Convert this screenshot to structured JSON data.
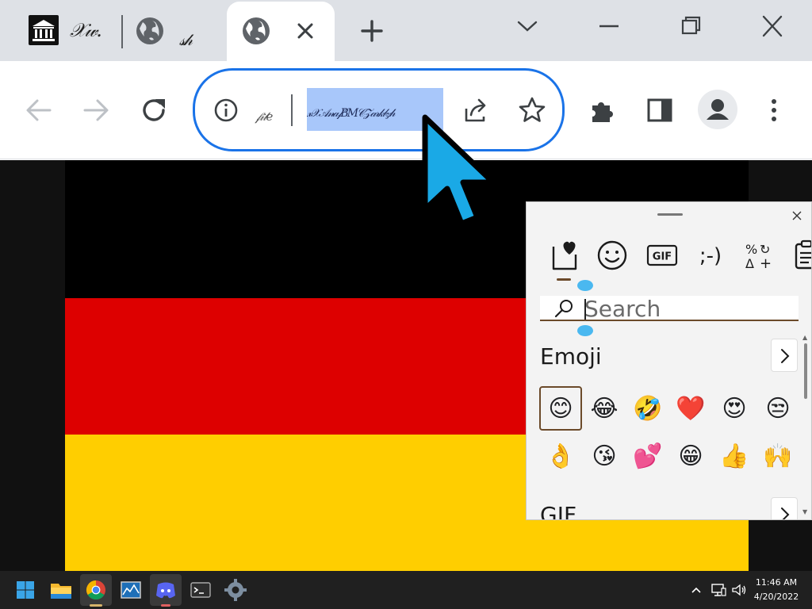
{
  "browser": {
    "tabs": [
      {
        "title": "𝒳𝓌.",
        "favicon": "museum-icon"
      },
      {
        "title": "𝓈𝒽",
        "favicon": "globe-icon"
      },
      {
        "title": "",
        "favicon": "globe-icon",
        "active": true
      }
    ],
    "window_controls": [
      "tab-search-icon",
      "minimize-icon",
      "restore-icon",
      "close-icon"
    ]
  },
  "toolbar": {
    "address": {
      "scheme": "𝒻𝒾𝓁𝑒",
      "selected_url": "𝓍𝒳𝒜𝓃𝒶𝒻𝐵𝑀𝒞𝒵𝒶𝓇𝓀𝒷𝓏𝒽"
    }
  },
  "page": {
    "flag_colors": [
      "#000000",
      "#DD0000",
      "#FFCE00"
    ]
  },
  "emoji_panel": {
    "categories": [
      "favorites-icon",
      "emoji-icon",
      "gif-icon",
      "kaomoji-icon",
      "symbols-icon",
      "clipboard-icon"
    ],
    "categories_text": {
      "gif": "GIF",
      "kaomoji": ";-)"
    },
    "search": {
      "placeholder": "Search",
      "value": ""
    },
    "sections": {
      "emoji": "Emoji",
      "gif": "GIF"
    },
    "emoji_rows": [
      [
        "😊",
        "😂",
        "🤣",
        "❤️",
        "😍",
        "😒"
      ],
      [
        "👌",
        "😘",
        "💕",
        "😁",
        "👍",
        "🙌"
      ]
    ]
  },
  "taskbar": {
    "apps": [
      "start-icon",
      "file-explorer-icon",
      "chrome-icon",
      "resource-monitor-icon",
      "discord-icon",
      "terminal-icon",
      "settings-icon"
    ],
    "clock": {
      "time": "11:46 AM",
      "date": "4/20/2022"
    }
  }
}
